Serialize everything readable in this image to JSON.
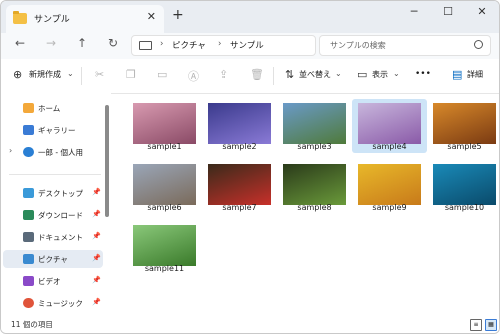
{
  "window": {
    "tab_title": "サンプル",
    "tab_close": "✕",
    "new_tab": "+",
    "minimize": "─",
    "maximize": "☐",
    "close": "✕"
  },
  "nav": {
    "back": "←",
    "forward": "→",
    "up": "↑",
    "refresh": "↻",
    "breadcrumb": [
      "ピクチャ",
      "サンプル"
    ],
    "breadcrumb_sep": "›",
    "search_placeholder": "サンプルの検索"
  },
  "commands": {
    "new_label": "新規作成",
    "sort_label": "並べ替え",
    "view_label": "表示",
    "more_label": "•••",
    "details_label": "詳細"
  },
  "sidebar": {
    "items": [
      {
        "label": "ホーム",
        "icon": "home-icon",
        "pinned": false
      },
      {
        "label": "ギャラリー",
        "icon": "gallery-icon",
        "pinned": false
      },
      {
        "label": "一郎 - 個人用",
        "icon": "cloud-icon",
        "pinned": false
      },
      {
        "label": "デスクトップ",
        "icon": "desktop-icon",
        "pinned": true
      },
      {
        "label": "ダウンロード",
        "icon": "download-icon",
        "pinned": true
      },
      {
        "label": "ドキュメント",
        "icon": "document-icon",
        "pinned": true
      },
      {
        "label": "ピクチャ",
        "icon": "pictures-icon",
        "pinned": true
      },
      {
        "label": "ビデオ",
        "icon": "video-icon",
        "pinned": true
      },
      {
        "label": "ミュージック",
        "icon": "music-icon",
        "pinned": true
      }
    ]
  },
  "files": [
    {
      "name": "sample1",
      "colors": [
        "#d89ab0",
        "#8a4a66"
      ]
    },
    {
      "name": "sample2",
      "colors": [
        "#3a3a8c",
        "#8a7ad6"
      ]
    },
    {
      "name": "sample3",
      "colors": [
        "#6a9ac8",
        "#4f7a3a"
      ]
    },
    {
      "name": "sample4",
      "colors": [
        "#c8b6dc",
        "#8a5aa8"
      ],
      "selected": true
    },
    {
      "name": "sample5",
      "colors": [
        "#d8892a",
        "#7a3a12"
      ]
    },
    {
      "name": "sample6",
      "colors": [
        "#9aa6b8",
        "#7a6a5a"
      ]
    },
    {
      "name": "sample7",
      "colors": [
        "#3a2a1a",
        "#c8302a"
      ]
    },
    {
      "name": "sample8",
      "colors": [
        "#2a3a1a",
        "#6a9a3a"
      ]
    },
    {
      "name": "sample9",
      "colors": [
        "#e8b82a",
        "#c87a1a"
      ]
    },
    {
      "name": "sample10",
      "colors": [
        "#1a8ab8",
        "#0a4a6a"
      ]
    },
    {
      "name": "sample11",
      "colors": [
        "#8ac87a",
        "#3a7a2a"
      ]
    }
  ],
  "status": {
    "count_text": "11 個の項目"
  },
  "colors": {
    "accent": "#0067c0",
    "selected_tile": "#cde4f7",
    "sidebar_selected": "#e5ebf3"
  }
}
